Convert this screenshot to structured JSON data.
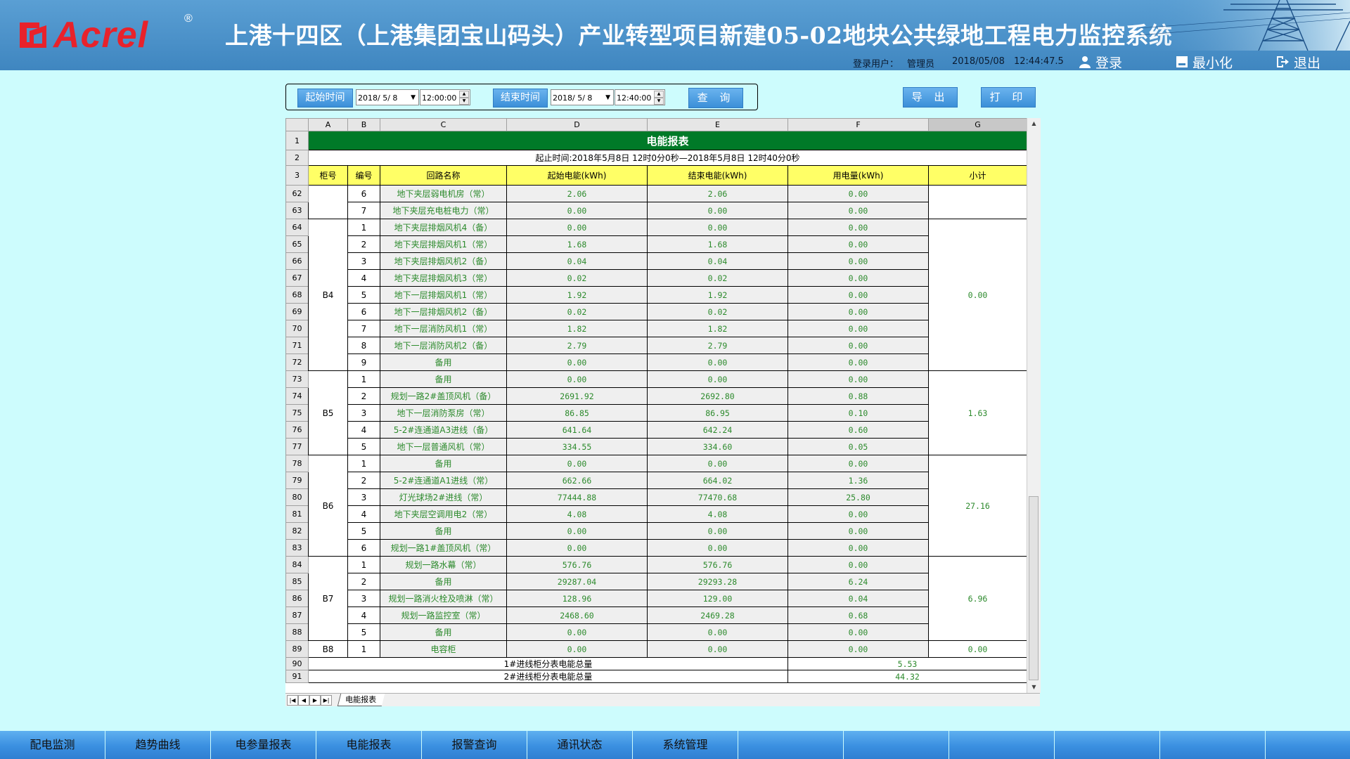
{
  "header": {
    "logo_text": "Acrel",
    "logo_reg": "®",
    "title": "上港十四区（上港集团宝山码头）产业转型项目新建05-02地块公共绿地工程电力监控系统",
    "user_label": "登录用户：",
    "user_name": "管理员",
    "date": "2018/05/08",
    "time": "12:44:47.5",
    "login_label": "登录",
    "minimize_label": "最小化",
    "exit_label": "退出"
  },
  "toolbar": {
    "start_label": "起始时间",
    "start_date": "2018/ 5/ 8",
    "start_time": "12:00:00",
    "end_label": "结束时间",
    "end_date": "2018/ 5/ 8",
    "end_time": "12:40:00",
    "query_label": "查 询",
    "export_label": "导 出",
    "print_label": "打 印"
  },
  "sheet": {
    "columns": [
      "A",
      "B",
      "C",
      "D",
      "E",
      "F",
      "G"
    ],
    "active_column": "G",
    "title": "电能报表",
    "period": "起止时间:2018年5月8日 12时0分0秒—2018年5月8日 12时40分0秒",
    "headers": [
      "柜号",
      "编号",
      "回路名称",
      "起始电能(kWh)",
      "结束电能(kWh)",
      "用电量(kWh)",
      "小计"
    ],
    "row_labels": {
      "title": "1",
      "period": "2",
      "header": "3"
    },
    "tab_name": "电能报表",
    "groups": [
      {
        "cabinet": "",
        "subtotal": "",
        "rows": [
          {
            "row": "62",
            "no": "6",
            "name": "地下夹层弱电机房（常）",
            "start": "2.06",
            "end": "2.06",
            "used": "0.00"
          },
          {
            "row": "63",
            "no": "7",
            "name": "地下夹层充电桩电力（常）",
            "start": "0.00",
            "end": "0.00",
            "used": "0.00"
          }
        ]
      },
      {
        "cabinet": "B4",
        "subtotal": "0.00",
        "rows": [
          {
            "row": "64",
            "no": "1",
            "name": "地下夹层排烟风机4（备）",
            "start": "0.00",
            "end": "0.00",
            "used": "0.00"
          },
          {
            "row": "65",
            "no": "2",
            "name": "地下夹层排烟风机1（常）",
            "start": "1.68",
            "end": "1.68",
            "used": "0.00"
          },
          {
            "row": "66",
            "no": "3",
            "name": "地下夹层排烟风机2（备）",
            "start": "0.04",
            "end": "0.04",
            "used": "0.00"
          },
          {
            "row": "67",
            "no": "4",
            "name": "地下夹层排烟风机3（常）",
            "start": "0.02",
            "end": "0.02",
            "used": "0.00"
          },
          {
            "row": "68",
            "no": "5",
            "name": "地下一层排烟风机1（常）",
            "start": "1.92",
            "end": "1.92",
            "used": "0.00"
          },
          {
            "row": "69",
            "no": "6",
            "name": "地下一层排烟风机2（备）",
            "start": "0.02",
            "end": "0.02",
            "used": "0.00"
          },
          {
            "row": "70",
            "no": "7",
            "name": "地下一层消防风机1（常）",
            "start": "1.82",
            "end": "1.82",
            "used": "0.00"
          },
          {
            "row": "71",
            "no": "8",
            "name": "地下一层消防风机2（备）",
            "start": "2.79",
            "end": "2.79",
            "used": "0.00"
          },
          {
            "row": "72",
            "no": "9",
            "name": "备用",
            "start": "0.00",
            "end": "0.00",
            "used": "0.00"
          }
        ]
      },
      {
        "cabinet": "B5",
        "subtotal": "1.63",
        "rows": [
          {
            "row": "73",
            "no": "1",
            "name": "备用",
            "start": "0.00",
            "end": "0.00",
            "used": "0.00"
          },
          {
            "row": "74",
            "no": "2",
            "name": "规划一路2#盖顶风机（备）",
            "start": "2691.92",
            "end": "2692.80",
            "used": "0.88"
          },
          {
            "row": "75",
            "no": "3",
            "name": "地下一层消防泵房（常）",
            "start": "86.85",
            "end": "86.95",
            "used": "0.10"
          },
          {
            "row": "76",
            "no": "4",
            "name": "5-2#连通道A3进线（备）",
            "start": "641.64",
            "end": "642.24",
            "used": "0.60"
          },
          {
            "row": "77",
            "no": "5",
            "name": "地下一层普通风机（常）",
            "start": "334.55",
            "end": "334.60",
            "used": "0.05"
          }
        ]
      },
      {
        "cabinet": "B6",
        "subtotal": "27.16",
        "rows": [
          {
            "row": "78",
            "no": "1",
            "name": "备用",
            "start": "0.00",
            "end": "0.00",
            "used": "0.00"
          },
          {
            "row": "79",
            "no": "2",
            "name": "5-2#连通道A1进线（常）",
            "start": "662.66",
            "end": "664.02",
            "used": "1.36"
          },
          {
            "row": "80",
            "no": "3",
            "name": "灯光球场2#进线（常）",
            "start": "77444.88",
            "end": "77470.68",
            "used": "25.80"
          },
          {
            "row": "81",
            "no": "4",
            "name": "地下夹层空调用电2（常）",
            "start": "4.08",
            "end": "4.08",
            "used": "0.00"
          },
          {
            "row": "82",
            "no": "5",
            "name": "备用",
            "start": "0.00",
            "end": "0.00",
            "used": "0.00"
          },
          {
            "row": "83",
            "no": "6",
            "name": "规划一路1#盖顶风机（常）",
            "start": "0.00",
            "end": "0.00",
            "used": "0.00"
          }
        ]
      },
      {
        "cabinet": "B7",
        "subtotal": "6.96",
        "rows": [
          {
            "row": "84",
            "no": "1",
            "name": "规划一路水幕（常）",
            "start": "576.76",
            "end": "576.76",
            "used": "0.00"
          },
          {
            "row": "85",
            "no": "2",
            "name": "备用",
            "start": "29287.04",
            "end": "29293.28",
            "used": "6.24"
          },
          {
            "row": "86",
            "no": "3",
            "name": "规划一路消火栓及喷淋（常）",
            "start": "128.96",
            "end": "129.00",
            "used": "0.04"
          },
          {
            "row": "87",
            "no": "4",
            "name": "规划一路监控室（常）",
            "start": "2468.60",
            "end": "2469.28",
            "used": "0.68"
          },
          {
            "row": "88",
            "no": "5",
            "name": "备用",
            "start": "0.00",
            "end": "0.00",
            "used": "0.00"
          }
        ]
      },
      {
        "cabinet": "B8",
        "subtotal": "0.00",
        "rows": [
          {
            "row": "89",
            "no": "1",
            "name": "电容柜",
            "start": "0.00",
            "end": "0.00",
            "used": "0.00"
          }
        ]
      }
    ],
    "totals": [
      {
        "row": "90",
        "label": "1#进线柜分表电能总量",
        "value": "5.53"
      },
      {
        "row": "91",
        "label": "2#进线柜分表电能总量",
        "value": "44.32"
      }
    ]
  },
  "bottom_nav": [
    "配电监测",
    "趋势曲线",
    "电参量报表",
    "电能报表",
    "报警查询",
    "通讯状态",
    "系统管理",
    "",
    "",
    "",
    "",
    "",
    ""
  ],
  "colors": {
    "accent": "#3b8fd8",
    "title_bar": "#007a28",
    "header_row": "#ffff66",
    "value_text": "#2c8a2c",
    "page_bg": "#cdfcfd"
  }
}
